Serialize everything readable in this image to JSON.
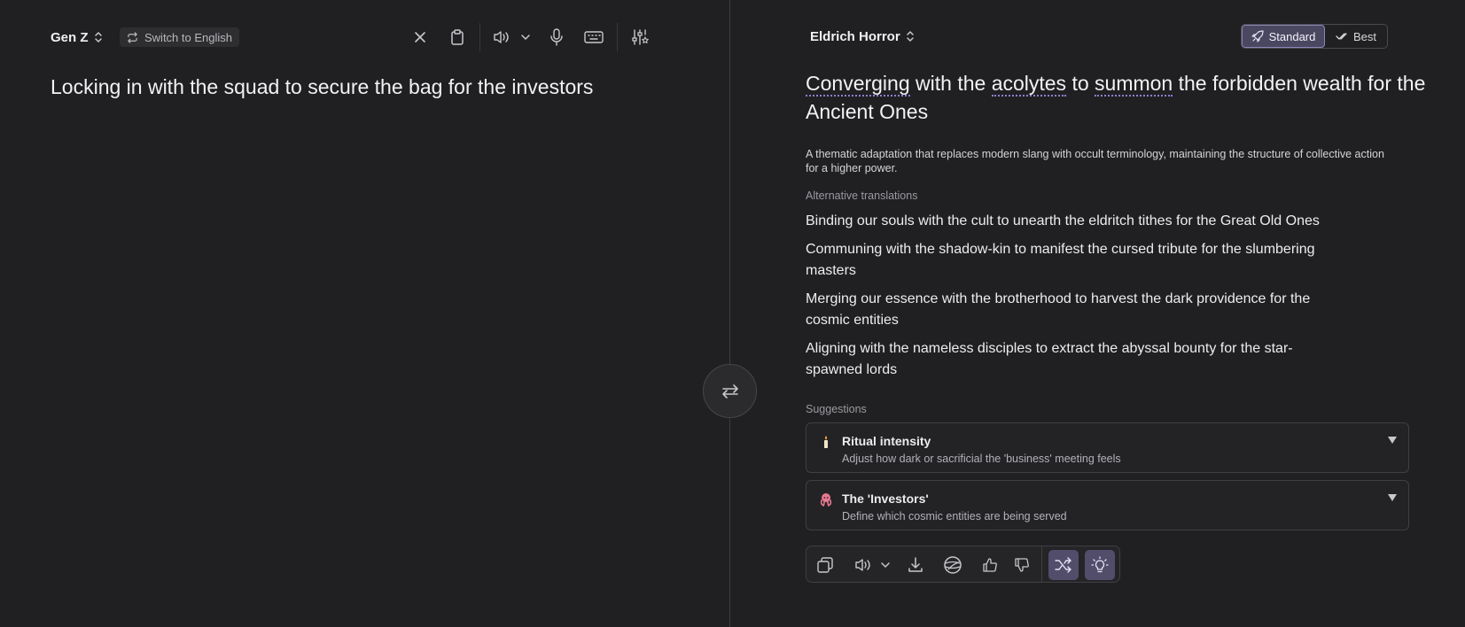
{
  "source": {
    "language": "Gen Z",
    "switch_label": "Switch to English",
    "text": "Locking in with the squad to secure the bag for the investors"
  },
  "target": {
    "language": "Eldrich Horror",
    "modes": {
      "standard": "Standard",
      "best": "Best",
      "selected": "Standard"
    },
    "translation": {
      "part1": "Converging",
      "part2": " with the ",
      "part3": "acolytes",
      "part4": " to ",
      "part5": "summon",
      "part6": " the forbidden wealth for the Ancient Ones"
    },
    "explanation": "A thematic adaptation that replaces modern slang with occult terminology, maintaining the structure of collective action for a higher power.",
    "alternatives_label": "Alternative translations",
    "alternatives": [
      "Binding our souls with the cult to unearth the eldritch tithes for the Great Old Ones",
      "Communing with the shadow-kin to manifest the cursed tribute for the slumbering masters",
      "Merging our essence with the brotherhood to harvest the dark providence for the cosmic entities",
      "Aligning with the nameless disciples to extract the abyssal bounty for the star-spawned lords"
    ],
    "suggestions_label": "Suggestions",
    "suggestions": [
      {
        "icon": "candle-icon",
        "title": "Ritual intensity",
        "description": "Adjust how dark or sacrificial the 'business' meeting feels"
      },
      {
        "icon": "octopus-icon",
        "title": "The 'Investors'",
        "description": "Define which cosmic entities are being served"
      }
    ]
  },
  "icons": {
    "left_toolbar": [
      "close-icon",
      "clipboard-icon",
      "speaker-icon",
      "chevron-down-icon",
      "microphone-icon",
      "keyboard-icon",
      "sliders-star-icon"
    ],
    "action_bar": [
      "copy-icon",
      "speaker-icon",
      "chevron-down-icon",
      "download-icon",
      "globe-icon",
      "thumbs-up-icon",
      "thumbs-down-icon",
      "shuffle-icon",
      "lightbulb-icon"
    ]
  },
  "colors": {
    "background": "#202022",
    "accent": "#8c86b8",
    "active_button": "#514d6a"
  }
}
